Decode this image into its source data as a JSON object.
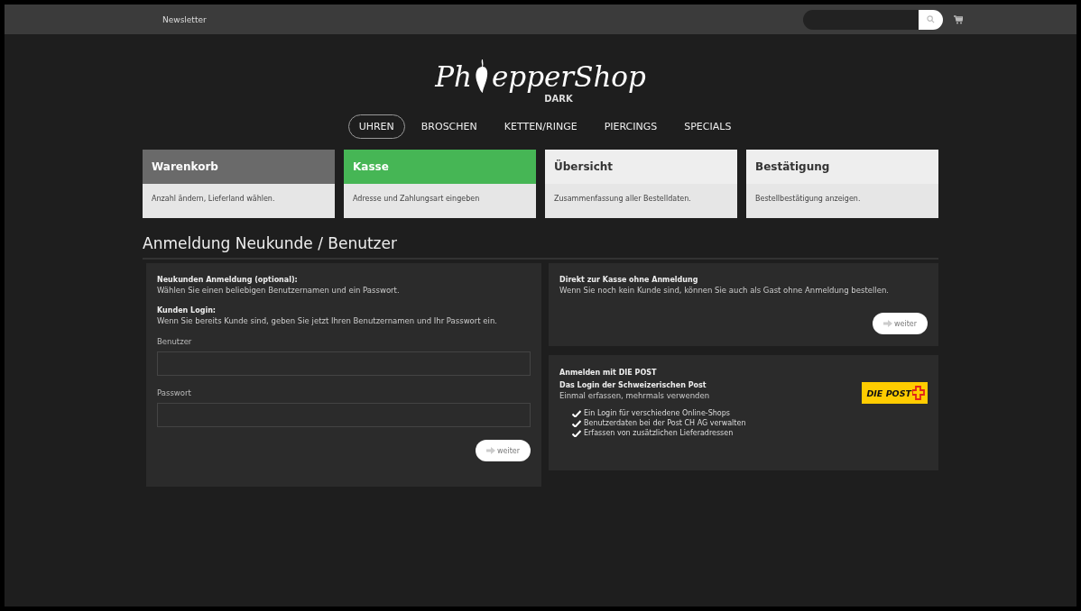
{
  "top_bar": {
    "link": "Newsletter",
    "search": {
      "kind": "pill"
    }
  },
  "logo": {
    "prefix": "Ph",
    "suffix": "epperShop",
    "subtitle": "DARK"
  },
  "nav": [
    {
      "label": "UHREN",
      "selected": true
    },
    {
      "label": "BROSCHEN",
      "selected": false
    },
    {
      "label": "KETTEN/RINGE",
      "selected": false
    },
    {
      "label": "PIERCINGS",
      "selected": false
    },
    {
      "label": "SPECIALS",
      "selected": false
    }
  ],
  "steps": [
    {
      "title": "Warenkorb",
      "text": "Anzahl ändern, Lieferland wählen.",
      "kind": "done"
    },
    {
      "title": "Kasse",
      "text": "Adresse und Zahlungsart eingeben",
      "kind": "current"
    },
    {
      "title": "Übersicht",
      "text": "Zusammenfassung aller Bestelldaten.",
      "kind": "upcoming"
    },
    {
      "title": "Bestätigung",
      "text": "Bestellbestätigung anzeigen.",
      "kind": "upcoming"
    }
  ],
  "heading": "Anmeldung Neukunde / Benutzer",
  "login_panel": {
    "sections": [
      {
        "title": "Neukunden Anmeldung (optional):",
        "text": "Wählen Sie einen beliebigen Benutzernamen und ein Passwort."
      },
      {
        "title": "Kunden Login:",
        "text": "Wenn Sie bereits Kunde sind, geben Sie jetzt Ihren Benutzernamen und Ihr Passwort ein."
      }
    ],
    "fields": [
      {
        "label": "Benutzer"
      },
      {
        "label": "Passwort"
      }
    ],
    "button": "weiter"
  },
  "guest_panel": {
    "title": "Direkt zur Kasse ohne Anmeldung",
    "text": "Wenn Sie noch kein Kunde sind, können Sie auch als Gast ohne Anmeldung bestellen.",
    "button": "weiter"
  },
  "post_panel": {
    "title": "Anmelden mit DIE POST",
    "subtitle": "Das Login der Schweizerischen Post",
    "text": "Einmal erfassen, mehrmals verwenden",
    "logo": "DIE POST",
    "features": [
      "Ein Login für verschiedene Online-Shops",
      "Benutzerdaten bei der Post CH AG verwalten",
      "Erfassen von zusätzlichen Lieferadressen"
    ]
  }
}
